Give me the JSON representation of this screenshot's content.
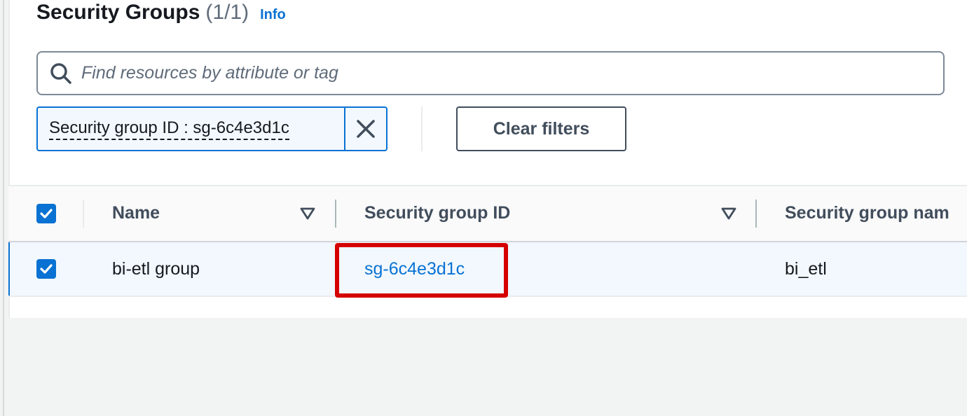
{
  "header": {
    "title": "Security Groups",
    "count": "(1/1)",
    "info_label": "Info"
  },
  "search": {
    "placeholder": "Find resources by attribute or tag",
    "value": "",
    "icon": "search-icon"
  },
  "filter_token": {
    "label": "Security group ID : sg-6c4e3d1c",
    "remove_icon": "close-icon"
  },
  "clear_filters_label": "Clear filters",
  "table": {
    "columns": [
      {
        "label": "Name"
      },
      {
        "label": "Security group ID"
      },
      {
        "label": "Security group nam"
      }
    ],
    "rows": [
      {
        "selected": true,
        "name": "bi-etl group",
        "security_group_id": "sg-6c4e3d1c",
        "security_group_name": "bi_etl"
      }
    ],
    "select_all_checked": true
  },
  "colors": {
    "accent": "#0972d3",
    "highlight": "#d50000"
  }
}
